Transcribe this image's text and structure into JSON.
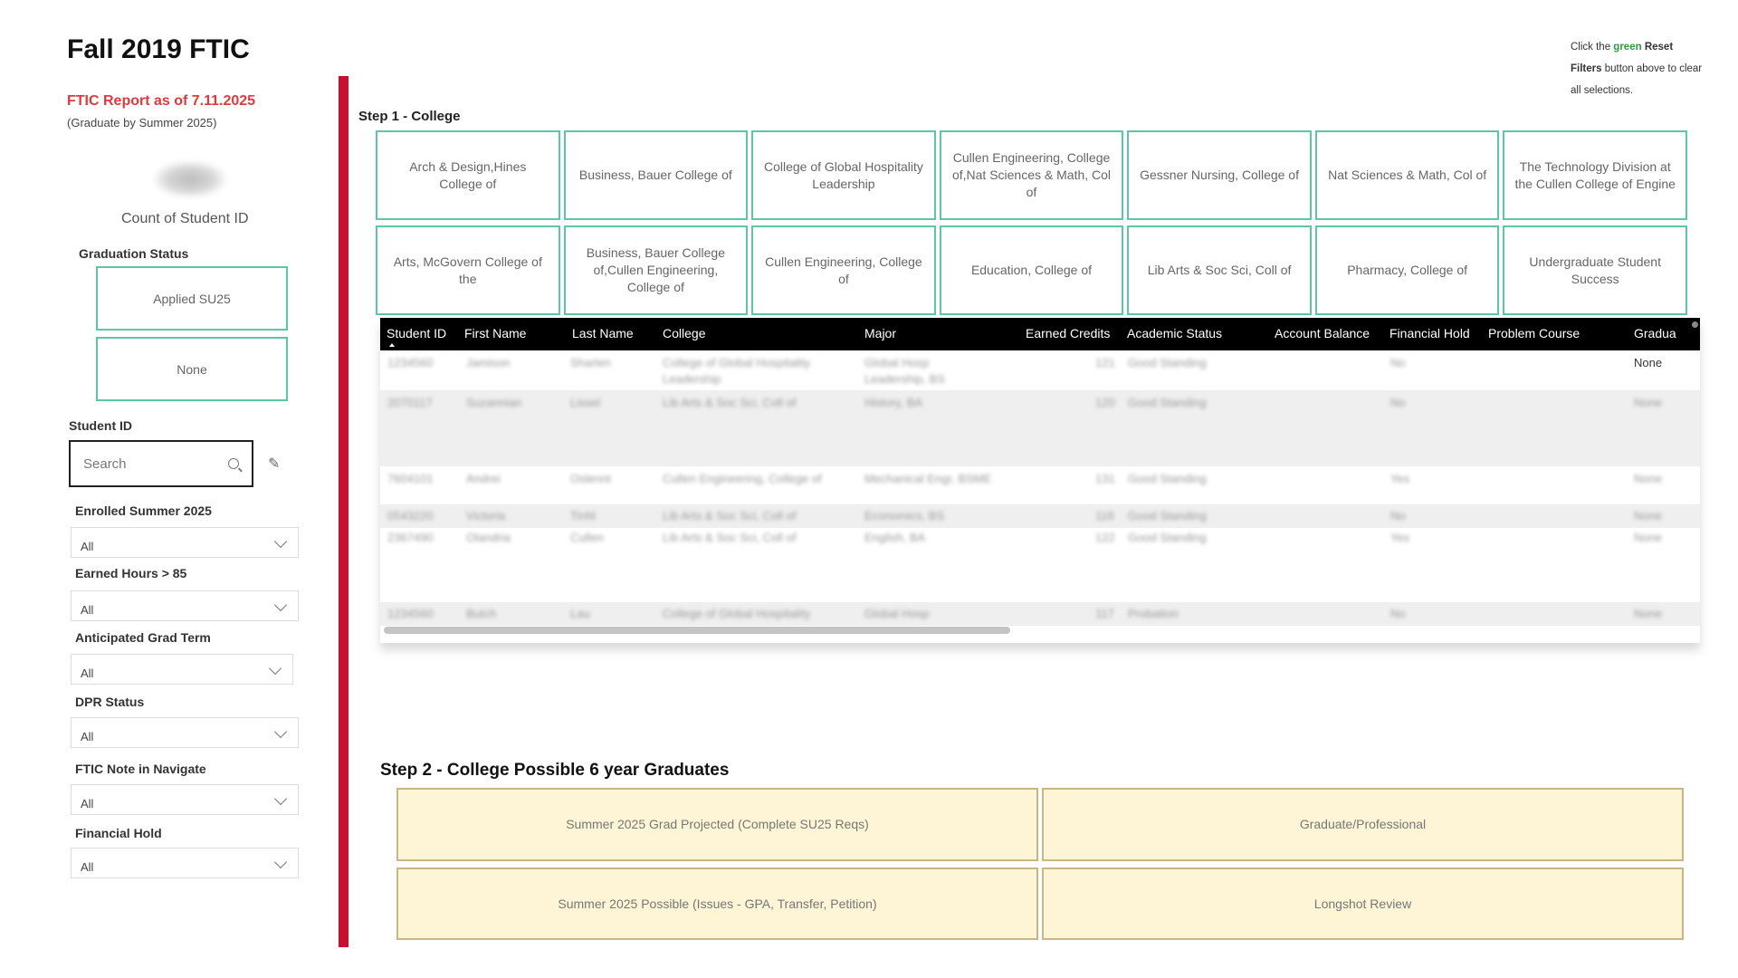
{
  "title": "Fall 2019 FTIC",
  "report": {
    "as_of": "FTIC Report as of 7.11.2025",
    "subtitle": "(Graduate by Summer 2025)"
  },
  "count_card": {
    "label": "Count of Student ID"
  },
  "graduation_status": {
    "label": "Graduation Status",
    "options": [
      "Applied SU25",
      "None"
    ]
  },
  "student_id": {
    "label": "Student ID",
    "placeholder": "Search"
  },
  "filters": [
    {
      "label": "Enrolled Summer 2025",
      "value": "All"
    },
    {
      "label": "Earned Hours > 85",
      "value": "All"
    },
    {
      "label": "Anticipated Grad Term",
      "value": "All"
    },
    {
      "label": "DPR Status",
      "value": "All"
    },
    {
      "label": "FTIC Note in Navigate",
      "value": "All"
    },
    {
      "label": "Financial Hold",
      "value": "All"
    }
  ],
  "reset_note": {
    "pre": "Click the ",
    "green": "green",
    "bold": "Reset Filters",
    "post": " button above to clear all selections.",
    "colors": {
      "green": "#2e9b3f"
    }
  },
  "step1": {
    "title": "Step 1 - College",
    "colleges": [
      "Arch & Design,Hines College of",
      "Business, Bauer College of",
      "College of Global Hospitality Leadership",
      "Cullen Engineering, College of,Nat Sciences & Math, Col of",
      "Gessner Nursing, College of",
      "Nat Sciences & Math, Col of",
      "The Technology Division at the Cullen College of Engine",
      "Arts, McGovern College of the",
      "Business, Bauer College of,Cullen Engineering, College of",
      "Cullen Engineering, College of",
      "Education, College of",
      "Lib Arts & Soc Sci, Coll of",
      "Pharmacy, College of",
      "Undergraduate Student Success"
    ]
  },
  "table": {
    "columns": [
      "Student ID",
      "First Name",
      "Last Name",
      "College",
      "Major",
      "Earned Credits",
      "Academic Status",
      "Account Balance",
      "Financial Hold",
      "Problem Course",
      "Gradua"
    ],
    "rows": [
      {
        "id": "1234560",
        "first": "Jamison",
        "last": "Sharlen",
        "college": "College of Global Hospitality",
        "college2": "Leadership",
        "major": "Global Hosp",
        "major2": "Leadership, BS",
        "credits": "121",
        "status": "Good Standing",
        "hold": "No",
        "grad": "None"
      },
      {
        "id": "2070117",
        "first": "Suzannian",
        "last": "Lissel",
        "college": "Lib Arts & Soc Sci, Coll of",
        "college2": "",
        "major": "History, BA",
        "major2": "",
        "credits": "120",
        "status": "Good Standing",
        "hold": "No",
        "grad": "None"
      },
      {
        "id": "7604101",
        "first": "Andrei",
        "last": "Oslennt",
        "college": "Cullen Engineering, College of",
        "college2": "",
        "major": "Mechanical Engr, BSME",
        "major2": "",
        "credits": "131",
        "status": "Good Standing",
        "hold": "Yes",
        "grad": "None"
      },
      {
        "id": "0543220",
        "first": "Victoria",
        "last": "Tinhl",
        "college": "Lib Arts & Soc Sci, Coll of",
        "college2": "",
        "major": "Economics, BS",
        "major2": "",
        "credits": "118",
        "status": "Good Standing",
        "hold": "No",
        "grad": "None"
      },
      {
        "id": "2367490",
        "first": "Olandria",
        "last": "Cullen",
        "college": "Lib Arts & Soc Sci, Coll of",
        "college2": "",
        "major": "English, BA",
        "major2": "",
        "credits": "122",
        "status": "Good Standing",
        "hold": "Yes",
        "grad": "None"
      },
      {
        "id": "1234560",
        "first": "Butch",
        "last": "Lau",
        "college": "College of Global Hospitality",
        "college2": "",
        "major": "Global Hosp",
        "major2": "",
        "credits": "117",
        "status": "Probation",
        "hold": "No",
        "grad": "None"
      }
    ]
  },
  "step2": {
    "title": "Step 2 - College Possible 6 year Graduates",
    "buttons": [
      "Summer 2025 Grad Projected (Complete SU25 Reqs)",
      "Graduate/Professional",
      "Summer 2025 Possible (Issues - GPA, Transfer, Petition)",
      "Longshot Review"
    ]
  },
  "colors": {
    "accent_red": "#c8102e",
    "report_red": "#e03a3e",
    "teal_border": "#5ec6a8",
    "step2_fill": "#fdf5d6",
    "step2_border": "#c9b687"
  }
}
